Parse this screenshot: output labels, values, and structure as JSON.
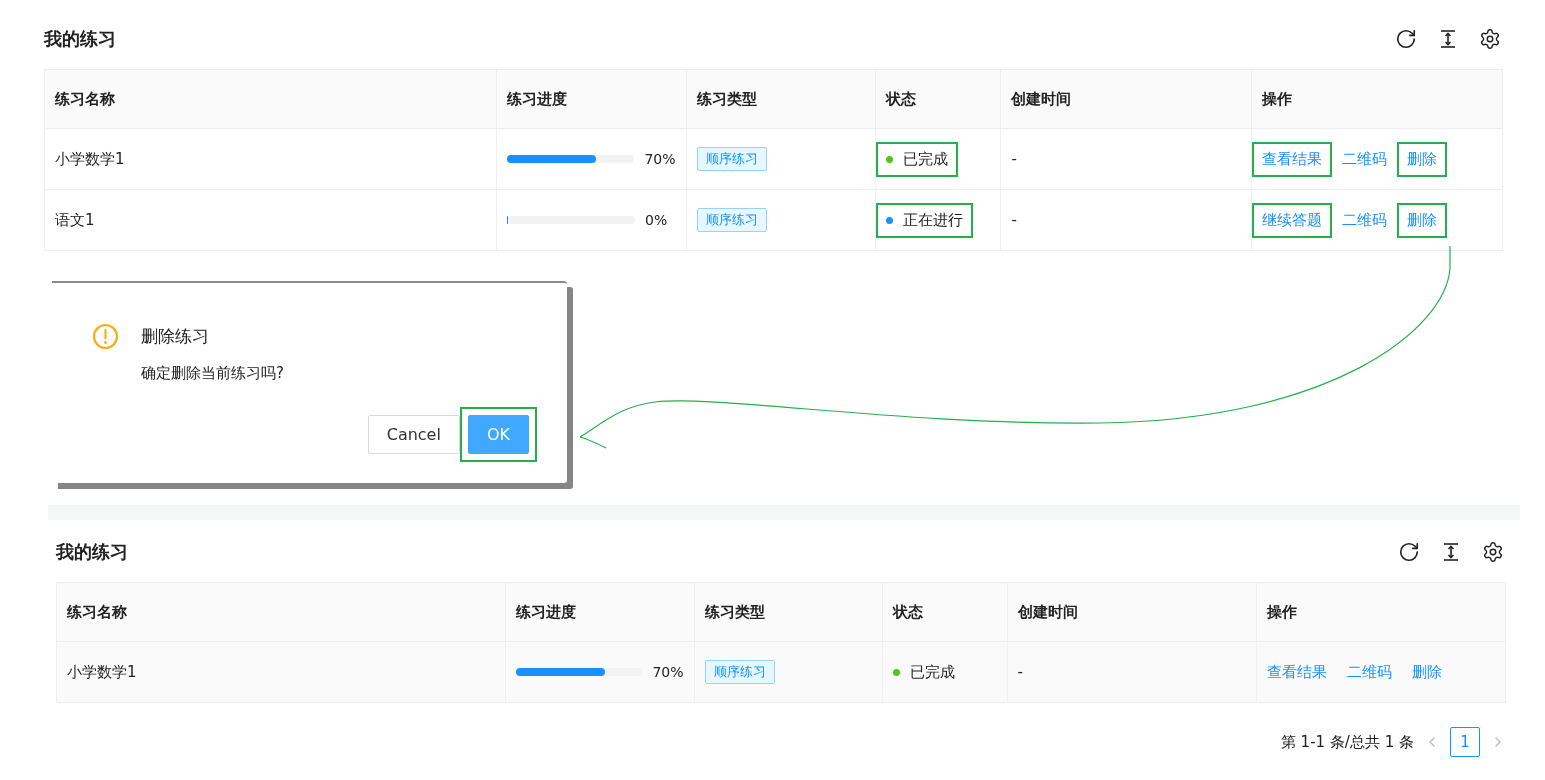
{
  "top_section": {
    "title": "我的练习",
    "columns": [
      "练习名称",
      "练习进度",
      "练习类型",
      "状态",
      "创建时间",
      "操作"
    ],
    "rows": [
      {
        "name": "小学数学1",
        "progress": {
          "level": 0.7,
          "label": "70%"
        },
        "type": "顺序练习",
        "status": {
          "text": "已完成",
          "color": "#52c41a",
          "highlighted": true
        },
        "created": "-",
        "actions": [
          {
            "label": "查看结果",
            "highlighted": true
          },
          {
            "label": "二维码"
          },
          {
            "label": "删除",
            "highlighted": true
          }
        ]
      },
      {
        "name": "语文1",
        "progress": {
          "level": 0,
          "label": "0%"
        },
        "type": "顺序练习",
        "status": {
          "text": "正在进行",
          "color": "#1890ff",
          "highlighted": true
        },
        "created": "-",
        "actions": [
          {
            "label": "继续答题",
            "highlighted": true
          },
          {
            "label": "二维码"
          },
          {
            "label": "删除",
            "highlighted": true
          }
        ]
      }
    ]
  },
  "dialog": {
    "title": "删除练习",
    "message": "确定删除当前练习吗?",
    "buttons": [
      {
        "label": "Cancel",
        "kind": "default"
      },
      {
        "label": "OK",
        "kind": "primary",
        "highlighted": true
      }
    ]
  },
  "bottom_section": {
    "title": "我的练习",
    "columns": [
      "练习名称",
      "练习进度",
      "练习类型",
      "状态",
      "创建时间",
      "操作"
    ],
    "rows": [
      {
        "name": "小学数学1",
        "progress": {
          "level": 0.7,
          "label": "70%"
        },
        "type": "顺序练习",
        "status": {
          "text": "已完成",
          "color": "#52c41a"
        },
        "created": "-",
        "actions": [
          {
            "label": "查看结果"
          },
          {
            "label": "二维码"
          },
          {
            "label": "删除"
          }
        ]
      }
    ],
    "pagination": {
      "summary": "第 1-1 条/总共 1 条",
      "pages": [
        {
          "label": "1",
          "selected": true
        }
      ]
    }
  }
}
